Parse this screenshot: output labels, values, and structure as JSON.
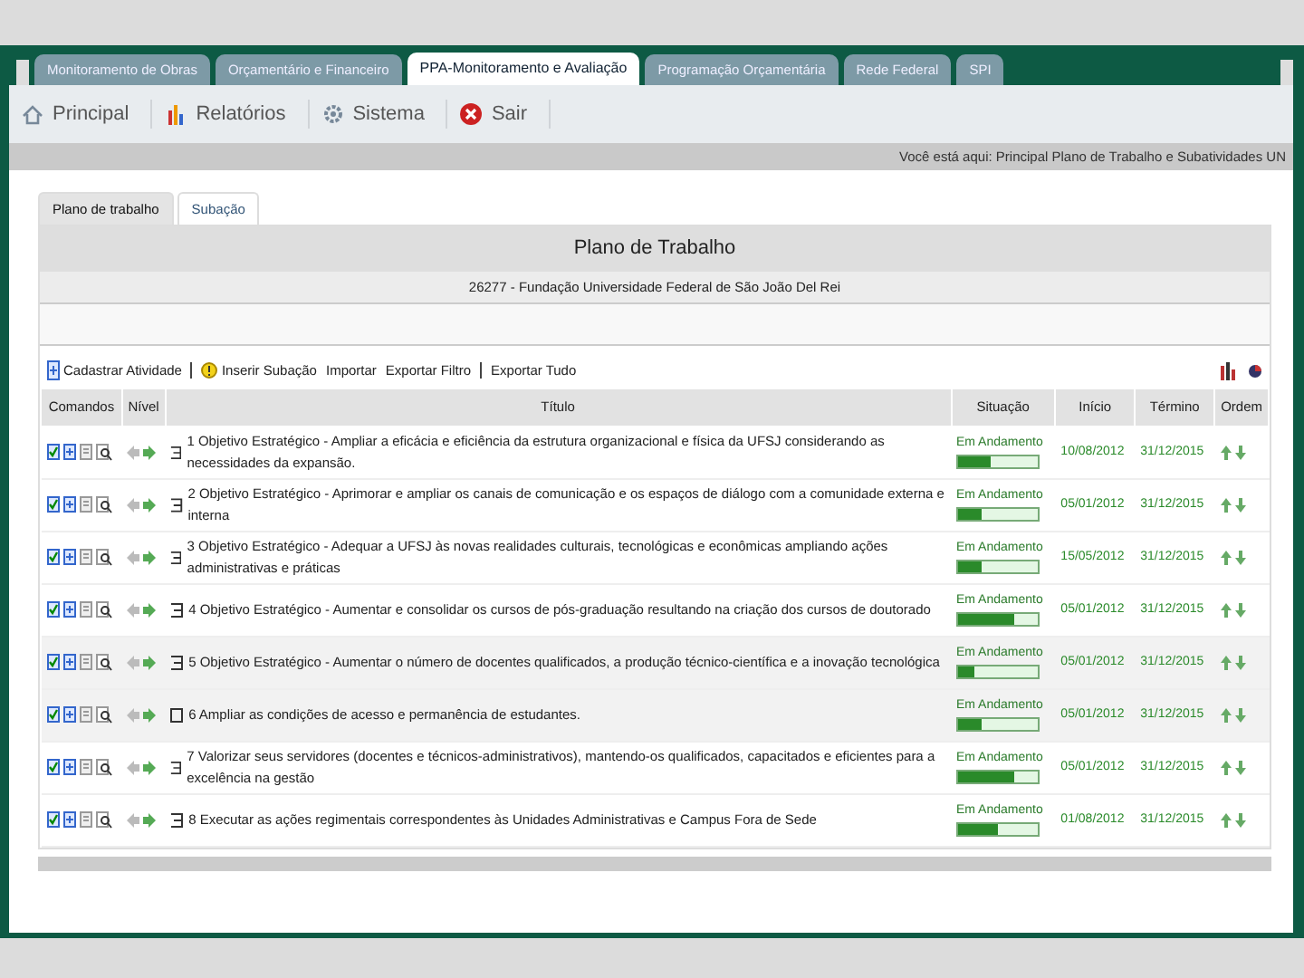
{
  "system_tabs": [
    {
      "label": "Monitoramento de Obras",
      "selected": false
    },
    {
      "label": "Orçamentário e Financeiro",
      "selected": false
    },
    {
      "label": "PPA-Monitoramento e Avaliação",
      "selected": true
    },
    {
      "label": "Programação Orçamentária",
      "selected": false
    },
    {
      "label": "Rede Federal",
      "selected": false
    },
    {
      "label": "SPI",
      "selected": false
    }
  ],
  "menu": [
    {
      "label": "Principal",
      "kind": "home"
    },
    {
      "label": "Relatórios",
      "kind": "reports"
    },
    {
      "label": "Sistema",
      "kind": "system"
    },
    {
      "label": "Sair",
      "kind": "exit"
    }
  ],
  "breadcrumb": "Você está aqui: Principal Plano de Trabalho e Subatividades UN",
  "page_tabs": [
    {
      "label": "Plano de trabalho",
      "selected": true
    },
    {
      "label": "Subação",
      "selected": false
    }
  ],
  "panel": {
    "title": "Plano de Trabalho",
    "subtitle": "26277 - Fundação Universidade Federal de São João Del Rei"
  },
  "toolbar": [
    {
      "label": "Cadastrar Atividade",
      "kind": "add"
    },
    {
      "label": "Inserir Subação",
      "kind": "warn"
    },
    {
      "label": "Importar",
      "kind": "plain"
    },
    {
      "label": "Exportar Filtro",
      "kind": "plain"
    },
    {
      "label": "Exportar Tudo",
      "kind": "plain"
    }
  ],
  "table": {
    "columns": [
      "Comandos",
      "Nível",
      "Título",
      "Situação",
      "Início",
      "Término",
      "Ordem"
    ],
    "rows": [
      {
        "expanded": true,
        "title": "1 Objetivo Estratégico - Ampliar a eficácia e eficiência da estrutura organizacional e física da UFSJ considerando as necessidades da expansão.",
        "status": "Em Andamento",
        "level": 0.4,
        "start": "10/08/2012",
        "end": "31/12/2015"
      },
      {
        "expanded": true,
        "title": "2 Objetivo Estratégico - Aprimorar e ampliar os canais de comunicação e os espaços de diálogo com a comunidade externa e interna",
        "status": "Em Andamento",
        "level": 0.3,
        "start": "05/01/2012",
        "end": "31/12/2015"
      },
      {
        "expanded": true,
        "title": "3 Objetivo Estratégico - Adequar a UFSJ às novas realidades culturais, tecnológicas e econômicas ampliando ações administrativas e práticas",
        "status": "Em Andamento",
        "level": 0.3,
        "start": "15/05/2012",
        "end": "31/12/2015"
      },
      {
        "expanded": true,
        "title": "4 Objetivo Estratégico - Aumentar e consolidar os cursos de pós-graduação resultando na criação dos cursos de doutorado",
        "status": "Em Andamento",
        "level": 0.7,
        "start": "05/01/2012",
        "end": "31/12/2015"
      },
      {
        "expanded": true,
        "title": "5 Objetivo Estratégico - Aumentar o número de docentes qualificados, a produção técnico-científica e a inovação tecnológica",
        "status": "Em Andamento",
        "level": 0.2,
        "start": "05/01/2012",
        "end": "31/12/2015"
      },
      {
        "expanded": false,
        "title": "6 Ampliar as condições de acesso e permanência de estudantes.",
        "status": "Em Andamento",
        "level": 0.3,
        "start": "05/01/2012",
        "end": "31/12/2015"
      },
      {
        "expanded": true,
        "title": "7 Valorizar seus servidores (docentes e técnicos-administrativos), mantendo-os qualificados, capacitados e eficientes para a excelência na gestão",
        "status": "Em Andamento",
        "level": 0.7,
        "start": "05/01/2012",
        "end": "31/12/2015"
      },
      {
        "expanded": true,
        "title": "8 Executar as ações regimentais correspondentes às Unidades Administrativas e Campus Fora de Sede",
        "status": "Em Andamento",
        "level": 0.5,
        "start": "01/08/2012",
        "end": "31/12/2015"
      }
    ]
  }
}
